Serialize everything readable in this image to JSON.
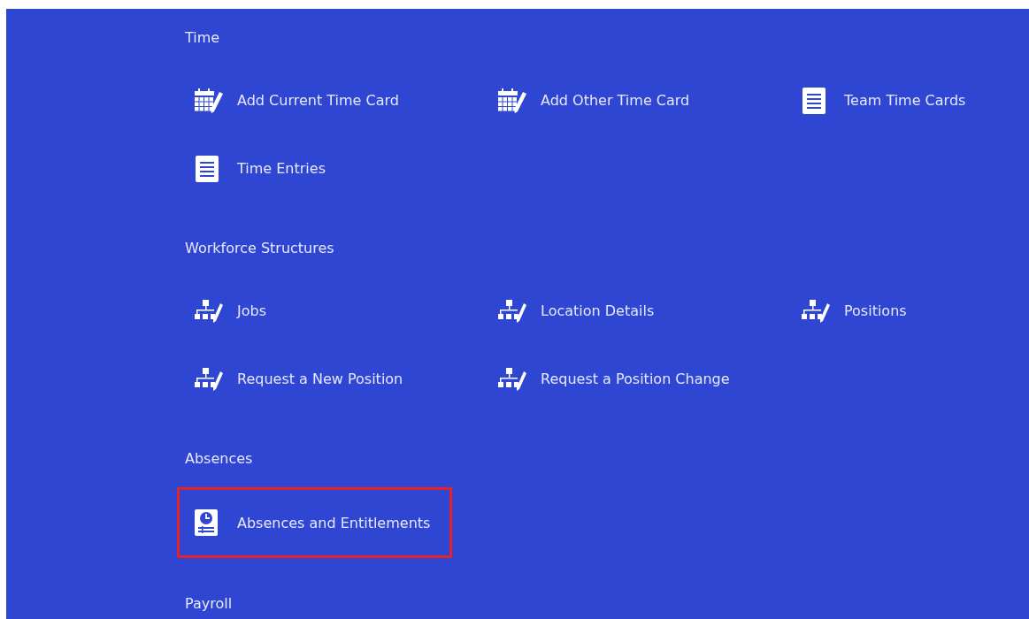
{
  "sections": [
    {
      "title": "Time",
      "items": [
        {
          "label": "Add Current Time Card",
          "kind": "calendar",
          "highlighted": false
        },
        {
          "label": "Add Other Time Card",
          "kind": "calendar",
          "highlighted": false
        },
        {
          "label": "Team Time Cards",
          "kind": "document",
          "highlighted": false
        },
        {
          "label": "Time Entries",
          "kind": "document",
          "highlighted": false
        }
      ]
    },
    {
      "title": "Workforce Structures",
      "items": [
        {
          "label": "Jobs",
          "kind": "org",
          "highlighted": false
        },
        {
          "label": "Location Details",
          "kind": "org",
          "highlighted": false
        },
        {
          "label": "Positions",
          "kind": "org",
          "highlighted": false
        },
        {
          "label": "Request a New Position",
          "kind": "org",
          "highlighted": false
        },
        {
          "label": "Request a Position Change",
          "kind": "org",
          "highlighted": false
        }
      ]
    },
    {
      "title": "Absences",
      "items": [
        {
          "label": "Absences and Entitlements",
          "kind": "absence",
          "highlighted": true
        }
      ]
    },
    {
      "title": "Payroll"
    }
  ]
}
